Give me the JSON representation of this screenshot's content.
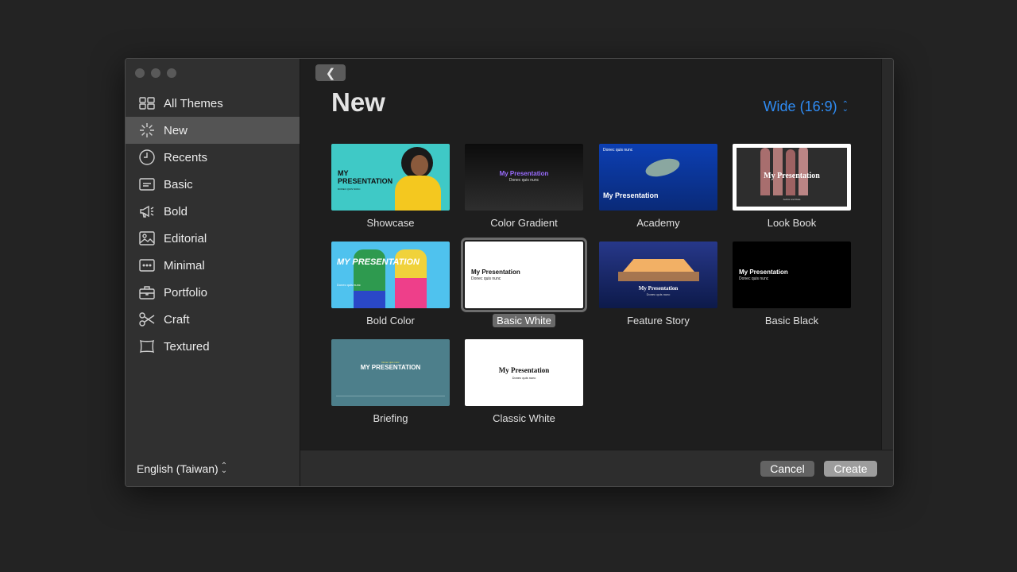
{
  "window": {
    "traffic_lights": [
      "close",
      "minimize",
      "zoom"
    ]
  },
  "sidebar": {
    "items": [
      {
        "label": "All Themes",
        "icon": "all-themes-icon"
      },
      {
        "label": "New",
        "icon": "new-icon",
        "selected": true
      },
      {
        "label": "Recents",
        "icon": "clock-icon"
      },
      {
        "label": "Basic",
        "icon": "basic-icon"
      },
      {
        "label": "Bold",
        "icon": "megaphone-icon"
      },
      {
        "label": "Editorial",
        "icon": "image-icon"
      },
      {
        "label": "Minimal",
        "icon": "ellipsis-box-icon"
      },
      {
        "label": "Portfolio",
        "icon": "briefcase-icon"
      },
      {
        "label": "Craft",
        "icon": "scissors-icon"
      },
      {
        "label": "Textured",
        "icon": "textured-icon"
      }
    ],
    "language": "English (Taiwan)"
  },
  "header": {
    "title": "New",
    "aspect_ratio": "Wide (16:9)"
  },
  "themes": [
    {
      "name": "Showcase",
      "thumb_title": "MY PRESENTATION",
      "thumb_sub": "DONEC QUIS NUNC"
    },
    {
      "name": "Color Gradient",
      "thumb_title": "My Presentation",
      "thumb_sub": "Donec quis nunc"
    },
    {
      "name": "Academy",
      "thumb_title": "My Presentation",
      "thumb_sub": "Donec quis nunc"
    },
    {
      "name": "Look Book",
      "thumb_title": "My Presentation",
      "thumb_sub": "Author and Date"
    },
    {
      "name": "Bold Color",
      "thumb_title": "MY PRESENTATION",
      "thumb_sub": "Donec quis nunc"
    },
    {
      "name": "Basic White",
      "thumb_title": "My Presentation",
      "thumb_sub": "Donec quis nunc",
      "selected": true
    },
    {
      "name": "Feature Story",
      "thumb_title": "My Presentation",
      "thumb_sub": "Donec quis nunc"
    },
    {
      "name": "Basic Black",
      "thumb_title": "My Presentation",
      "thumb_sub": "Donec quis nunc"
    },
    {
      "name": "Briefing",
      "thumb_title": "MY PRESENTATION",
      "thumb_sub": "Donec quis nunc"
    },
    {
      "name": "Classic White",
      "thumb_title": "My Presentation",
      "thumb_sub": "Donec quis nunc"
    }
  ],
  "footer": {
    "cancel": "Cancel",
    "create": "Create"
  },
  "colors": {
    "accent": "#2f8cf4",
    "selected_row": "#545454",
    "sidebar_bg": "#303030",
    "main_bg": "#1e1e1e"
  }
}
